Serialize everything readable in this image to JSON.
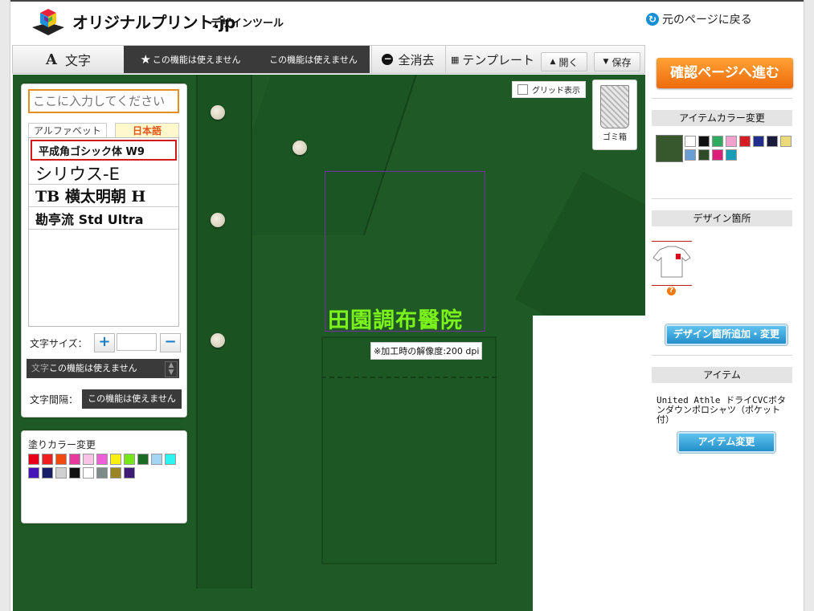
{
  "header": {
    "logo_text": "オリジナルプリント.jp",
    "logo_sub": "デザインツール",
    "back_link": "元のページに戻る"
  },
  "toolbar": {
    "text_label": "文字",
    "disabled_1": "この機能は使えません",
    "disabled_2": "この機能は使えません",
    "clear_all": "全消去",
    "template": "テンプレート",
    "open": "開く",
    "save": "保存"
  },
  "text_panel": {
    "input_placeholder": "ここに入力してください",
    "tab_alphabet": "アルファベット",
    "tab_japanese": "日本語",
    "fonts": [
      "平成角ゴシック体 W9",
      "シリウス-E",
      "TB 横太明朝 H",
      "勘亭流 Std Ultra"
    ],
    "size_label": "文字サイズ：",
    "size_value": "",
    "disabled_bar_label": "文字",
    "disabled_bar_text": "この機能は使えません",
    "spacing_label": "文字間隔：",
    "spacing_value": "この機能は使えません"
  },
  "fill_color": {
    "title": "塗りカラー変更",
    "colors": [
      "#e8001a",
      "#f01e1e",
      "#ef4b10",
      "#e8399c",
      "#f7c4e6",
      "#ef5fd8",
      "#f9ef15",
      "#77e817",
      "#1c6b25",
      "#a5d5f4",
      "#2ef3f3",
      "#4513b8",
      "#191d6a",
      "#d0d0d0",
      "#111111",
      "#ffffff",
      "#7e8c89",
      "#9a8526",
      "#3f1b78"
    ]
  },
  "canvas": {
    "grid_label": "グリッド表示",
    "trash_label": "ゴミ箱",
    "design_text": "田園調布醫院",
    "dpi_note": "※加工時の解像度:200 dpi"
  },
  "right_panel": {
    "confirm_button": "確認ページへ進む",
    "item_color_title": "アイテムカラー変更",
    "item_color_selected": "#37582d",
    "item_colors": [
      "#ffffff",
      "#111111",
      "#2eaa5e",
      "#f2a2cf",
      "#d81b24",
      "#232f8c",
      "#1b1b3b",
      "#ecd97a",
      "#6a9fd6",
      "#2f4a26",
      "#de1d7b",
      "#1a9eb5"
    ],
    "design_location_title": "デザイン箇所",
    "design_location_button": "デザイン箇所追加・変更",
    "item_title": "アイテム",
    "item_name": "United Athle ドライCVCボタンダウンポロシャツ（ポケット付）",
    "item_change_button": "アイテム変更"
  }
}
